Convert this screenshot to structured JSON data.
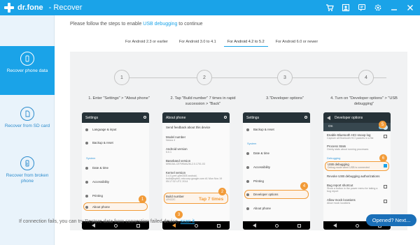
{
  "app": {
    "name": "dr.fone",
    "title": "- Recover"
  },
  "toolbar_icons": [
    "cart-icon",
    "account-icon",
    "feedback-icon",
    "settings-icon",
    "minimize-icon",
    "close-icon"
  ],
  "sidebar": {
    "items": [
      {
        "label": "Recover phone data",
        "icon": "phone-icon",
        "active": true
      },
      {
        "label": "Recover from SD card",
        "icon": "sd-card-icon",
        "active": false
      },
      {
        "label": "Recover from broken phone",
        "icon": "broken-phone-icon",
        "active": false
      }
    ]
  },
  "instruction": {
    "prefix": "Please follow the steps to enable ",
    "link": "USB debugging",
    "suffix": " to continue"
  },
  "tabs": [
    {
      "label": "For Android 2.3 or earlier"
    },
    {
      "label": "For Android 3.0 to 4.1"
    },
    {
      "label": "For Android 4.2 to 5.2"
    },
    {
      "label": "For Android 6.0 or newer"
    }
  ],
  "steps": [
    {
      "num": "1",
      "desc": "1. Enter \"Settings\" > \"About phone\""
    },
    {
      "num": "2",
      "desc": "2. Tap \"Build number\" 7 times in rapid succession > \"Back\""
    },
    {
      "num": "3",
      "desc": "3.\"Developer options\""
    },
    {
      "num": "4",
      "desc": "4. Turn on \"Developer options\" > \"USB debugging\""
    }
  ],
  "phone1": {
    "header": "Settings",
    "rows": {
      "lang": "Language & input",
      "backup": "Backup & reset",
      "section": "System",
      "date": "Date & time",
      "access": "Accessibility",
      "print": "Printing",
      "about": "About phone"
    },
    "badge": "1",
    "badge3": "3"
  },
  "phone2": {
    "header": "About phone",
    "rows": {
      "feedback": "Send feedback about this device",
      "model": "Model number",
      "model_val": "Nexus 4",
      "android": "Android version",
      "android_val": "5.0.1",
      "baseband": "Baseband version",
      "baseband_val": "M9615A-CEFWMAZM-2.0.1701.03",
      "kernel": "Kernel version",
      "kernel_val": "3.4.0-perf-g9e0305 android-build@vpbs1.mtv.corp.google.com #1 Mon Nov 19 05:17:32 UTC 2014",
      "build": "Build number",
      "build_val": "LRX22C"
    },
    "tap": "Tap 7 times",
    "badge": "2"
  },
  "phone3": {
    "header": "Settings",
    "rows": {
      "backup": "Backup & reset",
      "section": "System",
      "date": "Date & time",
      "access": "Accessibility",
      "print": "Printing",
      "dev": "Developer options",
      "about": "About phone"
    },
    "badge": "4"
  },
  "phone4": {
    "header": "Developer options",
    "on": "On",
    "rows": {
      "bt": "Enable Bluetooth HCI snoop log",
      "bt_sub": "Capture all Bluetooth HCI packets in a file",
      "proc": "Process Stats",
      "proc_sub": "Geeky stats about running processes",
      "section": "Debugging",
      "usb": "USB debugging",
      "usb_sub": "Debug mode when USB is connected",
      "revoke": "Revoke USB debugging authorizations",
      "bug": "Bug report shortcut",
      "bug_sub": "Show a button in the power menu for taking a bug report",
      "mock": "Allow mock locations",
      "mock_sub": "Allow mock locations"
    },
    "badge5": "5",
    "badge6": "6"
  },
  "footer": {
    "text": "If connection fails, you can try Restore data from connection failed device, ",
    "link": "scan it"
  },
  "next_button": "Opened? Next..."
}
